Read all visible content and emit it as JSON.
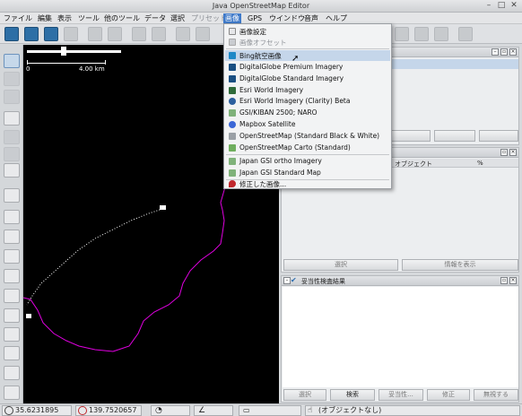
{
  "window": {
    "title": "Java OpenStreetMap Editor"
  },
  "menubar": {
    "items": [
      {
        "label": "ファイル",
        "state": "normal"
      },
      {
        "label": "編集",
        "state": "normal"
      },
      {
        "label": "表示",
        "state": "normal"
      },
      {
        "label": "ツール",
        "state": "normal"
      },
      {
        "label": "他のツール",
        "state": "normal"
      },
      {
        "label": "データ",
        "state": "normal"
      },
      {
        "label": "選択",
        "state": "normal"
      },
      {
        "label": "プリセット",
        "state": "disabled"
      },
      {
        "label": "画像",
        "state": "active"
      },
      {
        "label": "GPS",
        "state": "normal"
      },
      {
        "label": "ウインドウ",
        "state": "normal"
      },
      {
        "label": "音声",
        "state": "normal"
      },
      {
        "label": "ヘルプ",
        "state": "normal"
      }
    ]
  },
  "imagery_menu": {
    "items": [
      {
        "label": "画像設定",
        "icon": "preferences-icon",
        "state": "normal",
        "color": "#e6e7e9"
      },
      {
        "label": "画像オフセット",
        "icon": "offset-icon",
        "state": "disabled",
        "color": "#c9ccd0"
      },
      {
        "label": "Bing航空画像",
        "icon": "bing-icon",
        "state": "highlighted",
        "color": "#1d88c7"
      },
      {
        "label": "DigitalGlobe Premium Imagery",
        "icon": "digitalglobe-icon",
        "state": "normal",
        "color": "#1a4f82"
      },
      {
        "label": "DigitalGlobe Standard Imagery",
        "icon": "digitalglobe-icon",
        "state": "normal",
        "color": "#1a4f82"
      },
      {
        "label": "Esri World Imagery",
        "icon": "esri-icon",
        "state": "normal",
        "color": "#2f6b3a"
      },
      {
        "label": "Esri World Imagery (Clarity) Beta",
        "icon": "esri-globe-icon",
        "state": "normal",
        "color": "#2b5f9e"
      },
      {
        "label": "GSI/KIBAN 2500; NARO",
        "icon": "map-icon",
        "state": "normal",
        "color": "#7fb27a"
      },
      {
        "label": "Mapbox Satellite",
        "icon": "mapbox-icon",
        "state": "normal",
        "color": "#3b67d6"
      },
      {
        "label": "OpenStreetMap (Standard Black & White)",
        "icon": "osm-pencil-icon",
        "state": "normal",
        "color": "#9aa0a6"
      },
      {
        "label": "OpenStreetMap Carto (Standard)",
        "icon": "osm-pencil-icon",
        "state": "normal",
        "color": "#6fae5e"
      },
      {
        "label": "Japan GSI ortho Imagery",
        "icon": "map-icon",
        "state": "normal",
        "color": "#7fb27a"
      },
      {
        "label": "Japan GSI Standard Map",
        "icon": "map-icon",
        "state": "normal",
        "color": "#7fb27a"
      },
      {
        "label": "修正した画像...",
        "icon": "pin-icon",
        "state": "normal",
        "color": "#c0282d"
      }
    ]
  },
  "map": {
    "scale_start": "0",
    "scale_end": "4.00 km",
    "track_color": "#e000e0"
  },
  "panels": {
    "selection": {
      "column_object": "オブジェクト",
      "column_percent": "%",
      "select_button": "選択",
      "info_button": "情報を表示"
    },
    "validation": {
      "title": "妥当性検査結果",
      "buttons": [
        "選択",
        "検索",
        "妥当性...",
        "修正",
        "無視する"
      ]
    }
  },
  "statusbar": {
    "latitude": "35.6231895",
    "longitude": "139.7520657",
    "status_text": "(オブジェクトなし)"
  },
  "colors": {
    "menu_highlight": "#3f7ac9",
    "item_highlight": "#c5d6ea",
    "toolbar_active": "#2d6fa6"
  }
}
